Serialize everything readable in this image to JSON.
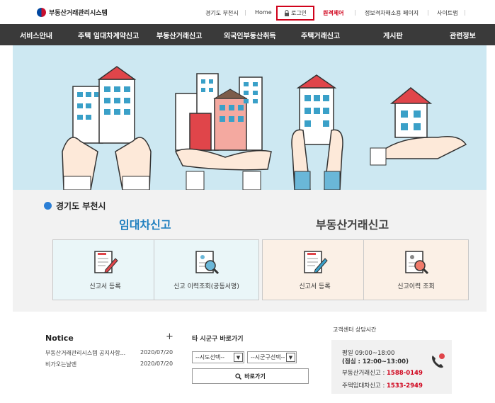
{
  "header": {
    "logo_text": "부동산거래관리시스템",
    "region_link": "경기도 부천시",
    "home": "Home",
    "login": "로그인",
    "remote_control": "원격제어",
    "accessibility": "정보격차해소용 페이지",
    "sitemap": "사이트맵"
  },
  "nav": {
    "items": [
      "서비스안내",
      "주택 임대차계약신고",
      "부동산거래신고",
      "외국인부동산취득",
      "주택거래신고",
      "게시판",
      "관련정보"
    ]
  },
  "main": {
    "region": "경기도 부천시",
    "section_rent": "임대차신고",
    "section_trade": "부동산거래신고",
    "cards": [
      {
        "label": "신고서 등록"
      },
      {
        "label": "신고 이력조회(공동서명)"
      },
      {
        "label": "신고서 등록"
      },
      {
        "label": "신고이력 조회"
      }
    ]
  },
  "notice": {
    "title": "Notice",
    "more": "+",
    "items": [
      {
        "title": "부동산거래관리시스템 공지사항...",
        "date": "2020/07/20"
      },
      {
        "title": "비가오는날엔",
        "date": "2020/07/20"
      }
    ]
  },
  "quick": {
    "title": "타 시군구 바로가기",
    "select_sido": "--시도선택--",
    "select_sigungu": "--시군구선택--",
    "go": "바로가기"
  },
  "contact": {
    "title": "고객센터 상담시간",
    "hours": "평일 09:00~18:00",
    "lunch": "(점심 : 12:00~13:00)",
    "trade_label": "부동산거래신고 : ",
    "trade_phone": "1588-0149",
    "rent_label": "주택임대차신고 : ",
    "rent_phone": "1533-2949"
  },
  "colors": {
    "nav_bg": "#3a3a3a",
    "accent_red": "#d0021b",
    "accent_blue": "#1f7fbf",
    "hero_bg": "#cde8f2"
  }
}
